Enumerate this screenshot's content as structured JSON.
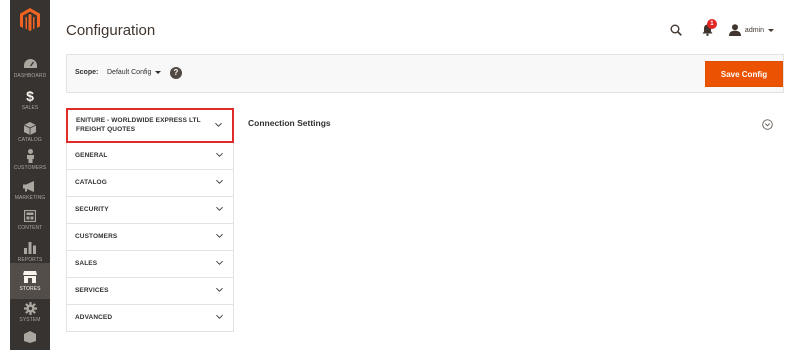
{
  "sidebar": {
    "logo": "magento-logo",
    "items": [
      {
        "label": "DASHBOARD",
        "icon": "speedometer-icon",
        "active": false
      },
      {
        "label": "SALES",
        "icon": "dollar-icon",
        "active": false
      },
      {
        "label": "CATALOG",
        "icon": "cube-icon",
        "active": false
      },
      {
        "label": "CUSTOMERS",
        "icon": "person-icon",
        "active": false
      },
      {
        "label": "MARKETING",
        "icon": "megaphone-icon",
        "active": false
      },
      {
        "label": "CONTENT",
        "icon": "layout-icon",
        "active": false
      },
      {
        "label": "REPORTS",
        "icon": "bar-chart-icon",
        "active": false
      },
      {
        "label": "STORES",
        "icon": "store-icon",
        "active": true
      },
      {
        "label": "SYSTEM",
        "icon": "gear-icon",
        "active": false
      }
    ]
  },
  "header": {
    "title": "Configuration",
    "notification_count": "1",
    "user_name": "admin"
  },
  "scope": {
    "label": "Scope:",
    "value": "Default Config",
    "help": "?"
  },
  "save_button": {
    "label": "Save Config"
  },
  "tabs": [
    {
      "label": "ENITURE - WORLDWIDE EXPRESS LTL FREIGHT QUOTES"
    },
    {
      "label": "GENERAL"
    },
    {
      "label": "CATALOG"
    },
    {
      "label": "SECURITY"
    },
    {
      "label": "CUSTOMERS"
    },
    {
      "label": "SALES"
    },
    {
      "label": "SERVICES"
    },
    {
      "label": "ADVANCED"
    }
  ],
  "content": {
    "section_title": "Connection Settings"
  },
  "colors": {
    "sidebar_bg": "#373330",
    "accent_orange": "#eb5202",
    "highlight_red": "#e02b27",
    "badge_red": "#e22626"
  }
}
